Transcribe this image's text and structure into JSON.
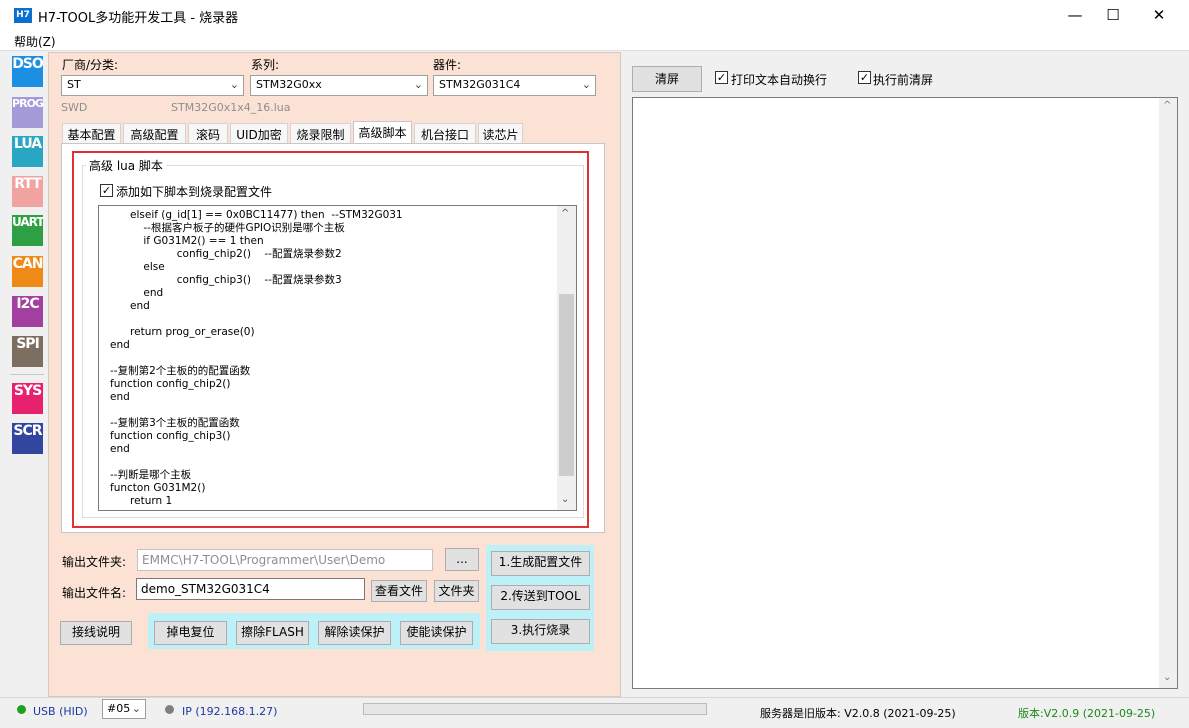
{
  "window": {
    "icon_text": "H7",
    "title": "H7-TOOL多功能开发工具 - 烧录器",
    "minimize": "—",
    "maximize": "☐",
    "close": "✕"
  },
  "menu": {
    "help": "帮助(Z)"
  },
  "sidebar": [
    {
      "label": "DSO",
      "color": "#1c8fe3"
    },
    {
      "label": "PROG",
      "color": "#a49ad8"
    },
    {
      "label": "LUA",
      "color": "#2aa6c5"
    },
    {
      "label": "RTT",
      "color": "#f0a3a0"
    },
    {
      "label": "UART",
      "color": "#2f9f43"
    },
    {
      "label": "CAN",
      "color": "#f08a16"
    },
    {
      "label": "I2C",
      "color": "#a33fa0"
    },
    {
      "label": "SPI",
      "color": "#7c6e60"
    },
    {
      "label": "SYS",
      "color": "#e8216e"
    },
    {
      "label": "SCR",
      "color": "#3246a0"
    }
  ],
  "config": {
    "vendor_label": "厂商/分类:",
    "vendor_value": "ST",
    "series_label": "系列:",
    "series_value": "STM32G0xx",
    "device_label": "器件:",
    "device_value": "STM32G031C4",
    "interface": "SWD",
    "lua_file": "STM32G0x1x4_16.lua"
  },
  "tabs": [
    "基本配置",
    "高级配置",
    "滚码",
    "UID加密",
    "烧录限制",
    "高级脚本",
    "机台接口",
    "读芯片"
  ],
  "active_tab": "高级脚本",
  "script": {
    "group_title": "高级 lua 脚本",
    "checkbox_checked": "✓",
    "checkbox_label": "添加如下脚本到烧录配置文件",
    "code": "\t elseif (g_id[1] == 0x0BC11477) then  --STM32G031\n\t\t--根据客户板子的硬件GPIO识别是哪个主板\n\t\tif G031M2() == 1 then\n\t\t\t\tconfig_chip2()    --配置烧录参数2\n\t\telse\n\t\t\t\tconfig_chip3()    --配置烧录参数3\n\t\tend\n\t end\n\n\t return prog_or_erase(0)\nend\n\n--复制第2个主板的的配置函数\nfunction config_chip2()\nend\n\n--复制第3个主板的配置函数\nfunction config_chip3()\nend\n\n--判断是哪个主板\nfuncton G031M2()\n\t return 1"
  },
  "output": {
    "folder_label": "输出文件夹:",
    "folder_value": "EMMC\\H7-TOOL\\Programmer\\User\\Demo",
    "browse_label": "...",
    "filename_label": "输出文件名:",
    "filename_value": "demo_STM32G031C4",
    "view_file": "查看文件",
    "folder_btn": "文件夹"
  },
  "actions": {
    "generate": "1.生成配置文件",
    "transfer": "2.传送到TOOL",
    "execute": "3.执行烧录",
    "wiring": "接线说明",
    "power_reset": "掉电复位",
    "erase_flash": "擦除FLASH",
    "unlock_read": "解除读保护",
    "enable_read_protect": "使能读保护"
  },
  "right": {
    "clear_btn": "清屏",
    "wrap_label": "打印文本自动换行",
    "clear_before_label": "执行前清屏",
    "wrap_checked": "✓",
    "clear_before_checked": "✓"
  },
  "status": {
    "usb": "USB (HID)",
    "usb_color": "#20a020",
    "device_no": "#05",
    "ip": "IP (192.168.1.27)",
    "ip_color": "#808080",
    "server_version": "服务器是旧版本: V2.0.8 (2021-09-25)",
    "local_version": "版本:V2.0.9 (2021-09-25)",
    "local_version_color": "#1a8a1a"
  }
}
